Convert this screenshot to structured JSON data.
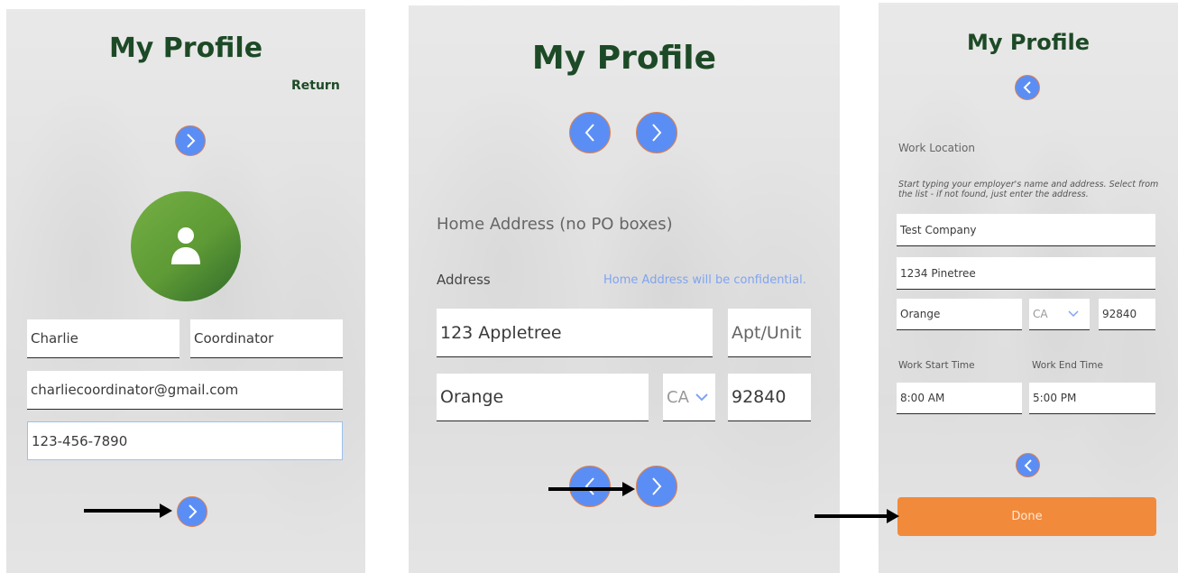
{
  "screen1": {
    "title": "My Profile",
    "return_label": "Return",
    "first_name": "Charlie",
    "last_name": "Coordinator",
    "email": "charliecoordinator@gmail.com",
    "phone": "123-456-7890"
  },
  "screen2": {
    "title": "My Profile",
    "section_label": "Home Address (no PO boxes)",
    "address_label": "Address",
    "confidential_note": "Home Address will be confidential.",
    "street": "123 Appletree",
    "apt_placeholder": "Apt/Unit",
    "city": "Orange",
    "state": "CA",
    "zip": "92840"
  },
  "screen3": {
    "title": "My Profile",
    "section_label": "Work Location",
    "hint": "Start typing your employer's name and address. Select from the list - if not found, just enter the address.",
    "company": "Test Company",
    "street": "1234 Pinetree",
    "city": "Orange",
    "state": "CA",
    "zip": "92840",
    "start_label": "Work Start Time",
    "end_label": "Work End Time",
    "start_time": "8:00 AM",
    "end_time": "5:00 PM",
    "done_label": "Done"
  },
  "colors": {
    "title_green": "#1d4a26",
    "nav_blue": "#5b8ef5",
    "done_orange": "#f28a3b",
    "avatar_green": "#5e9a35",
    "note_blue": "#7fa4f0"
  }
}
